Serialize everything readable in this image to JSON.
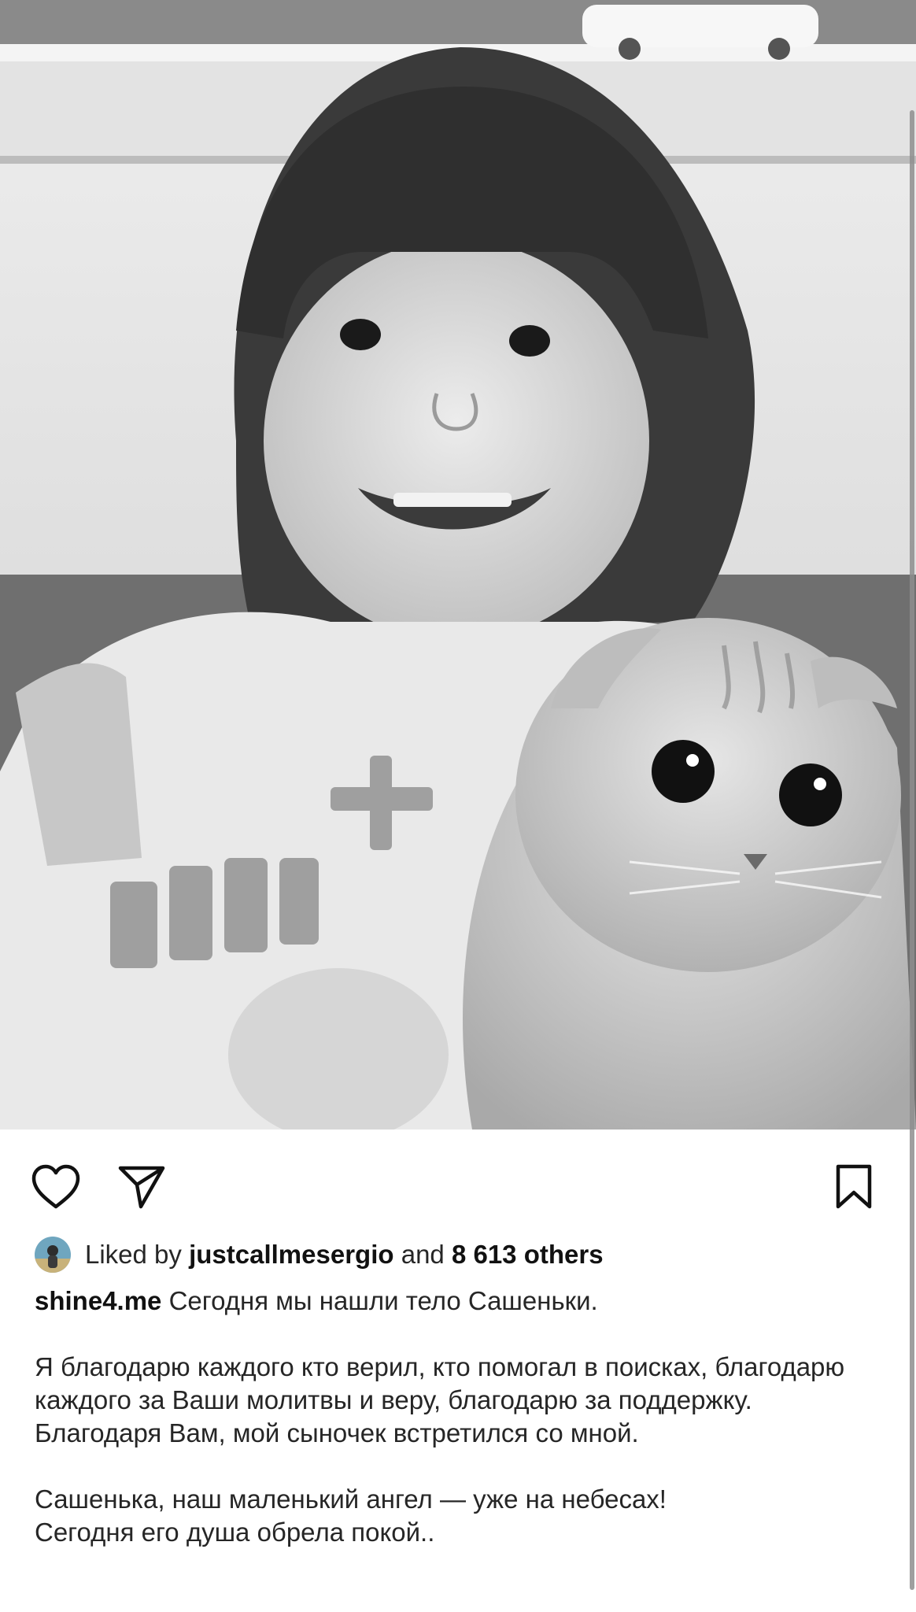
{
  "post": {
    "photo_alt": "black-and-white photo of a smiling child holding a fold-eared cat",
    "likes": {
      "prefix": "Liked by",
      "user": "justcallmesergio",
      "and": "and",
      "others": "8 613 others"
    },
    "caption": {
      "username": "shine4.me",
      "line1": "Сегодня мы нашли тело Сашеньки.",
      "paragraph2": "Я благодарю каждого кто верил, кто помогал в поисках, благодарю каждого за Ваши молитвы и веру, благодарю за поддержку. Благодаря Вам, мой сыночек встретился со мной.",
      "paragraph3_line1": "Сашенька, наш маленький ангел — уже на небесах!",
      "paragraph3_line2": "Сегодня его душа обрела покой.."
    }
  },
  "icons": {
    "like": "heart-outline-icon",
    "share": "paper-plane-icon",
    "save": "bookmark-outline-icon"
  },
  "colors": {
    "background": "#ffffff",
    "text": "#262626",
    "icon": "#111111"
  }
}
